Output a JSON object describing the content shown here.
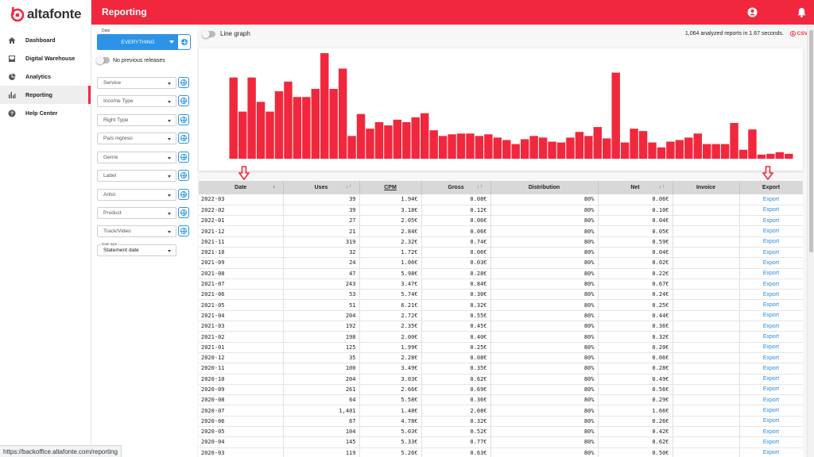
{
  "brand": {
    "name": "altafonte",
    "color": "#f1283d",
    "accent": "#2c93e8"
  },
  "sidebar": {
    "items": [
      {
        "label": "Dashboard",
        "icon": "home-icon",
        "active": false
      },
      {
        "label": "Digital Warehouse",
        "icon": "inbox-icon",
        "active": false
      },
      {
        "label": "Analytics",
        "icon": "pie-chart-icon",
        "active": false
      },
      {
        "label": "Reporting",
        "icon": "bar-chart-icon",
        "active": true
      },
      {
        "label": "Help Center",
        "icon": "help-icon",
        "active": false
      }
    ]
  },
  "topbar": {
    "title": "Reporting",
    "icons": [
      "account-icon",
      "bell-icon"
    ]
  },
  "filters": {
    "date_label": "Date",
    "date_value": "EVERYTHING",
    "no_previous_label": "No previous releases",
    "dropdowns": [
      "Service",
      "Income Type",
      "Right Type",
      "País ingreso",
      "Genre",
      "Label",
      "Artist",
      "Product",
      "Track/Video"
    ],
    "date_type_label": "Date type",
    "date_type_value": "Statement date"
  },
  "main": {
    "line_graph_label": "Line graph",
    "stats": "1,064 analyzed reports in 1.67 seconds.",
    "csv_label": "CSV"
  },
  "chart_data": {
    "type": "bar",
    "values": [
      100,
      58,
      100,
      70,
      58,
      83,
      95,
      76,
      76,
      86,
      130,
      86,
      111,
      28,
      55,
      37,
      45,
      41,
      48,
      45,
      51,
      56,
      35,
      28,
      30,
      31,
      31,
      28,
      30,
      26,
      23,
      18,
      24,
      28,
      26,
      21,
      20,
      26,
      33,
      28,
      39,
      25,
      106,
      20,
      37,
      34,
      20,
      14,
      21,
      23,
      26,
      31,
      18,
      18,
      18,
      44,
      11,
      36,
      5,
      6,
      8,
      6
    ],
    "color": "#f1283d"
  },
  "table": {
    "columns": [
      {
        "label": "Date",
        "sort": "↓"
      },
      {
        "label": "Uses",
        "sort": "↓↑"
      },
      {
        "label": "CPM",
        "sort": "",
        "underline": true
      },
      {
        "label": "Gross",
        "sort": "↓↑"
      },
      {
        "label": "Distribution",
        "sort": ""
      },
      {
        "label": "Net",
        "sort": "↓↑"
      },
      {
        "label": "Invoice",
        "sort": ""
      },
      {
        "label": "Export",
        "sort": ""
      }
    ],
    "rows": [
      [
        "2022-03",
        "39",
        "1.94€",
        "0.08€",
        "80%",
        "0.06€",
        "",
        "Export"
      ],
      [
        "2022-02",
        "39",
        "3.18€",
        "0.12€",
        "80%",
        "0.10€",
        "",
        "Export"
      ],
      [
        "2022-01",
        "27",
        "2.05€",
        "0.06€",
        "80%",
        "0.04€",
        "",
        "Export"
      ],
      [
        "2021-12",
        "21",
        "2.84€",
        "0.06€",
        "80%",
        "0.05€",
        "",
        "Export"
      ],
      [
        "2021-11",
        "319",
        "2.32€",
        "0.74€",
        "80%",
        "0.59€",
        "",
        "Export"
      ],
      [
        "2021-10",
        "32",
        "1.72€",
        "0.06€",
        "80%",
        "0.04€",
        "",
        "Export"
      ],
      [
        "2021-09",
        "24",
        "1.06€",
        "0.03€",
        "80%",
        "0.02€",
        "",
        "Export"
      ],
      [
        "2021-08",
        "47",
        "5.98€",
        "0.28€",
        "80%",
        "0.22€",
        "",
        "Export"
      ],
      [
        "2021-07",
        "243",
        "3.47€",
        "0.84€",
        "80%",
        "0.67€",
        "",
        "Export"
      ],
      [
        "2021-06",
        "53",
        "5.74€",
        "0.30€",
        "80%",
        "0.24€",
        "",
        "Export"
      ],
      [
        "2021-05",
        "51",
        "6.21€",
        "0.32€",
        "80%",
        "0.25€",
        "",
        "Export"
      ],
      [
        "2021-04",
        "204",
        "2.72€",
        "0.55€",
        "80%",
        "0.44€",
        "",
        "Export"
      ],
      [
        "2021-03",
        "192",
        "2.35€",
        "0.45€",
        "80%",
        "0.36€",
        "",
        "Export"
      ],
      [
        "2021-02",
        "198",
        "2.00€",
        "0.40€",
        "80%",
        "0.32€",
        "",
        "Export"
      ],
      [
        "2021-01",
        "125",
        "1.99€",
        "0.25€",
        "80%",
        "0.20€",
        "",
        "Export"
      ],
      [
        "2020-12",
        "35",
        "2.28€",
        "0.08€",
        "80%",
        "0.06€",
        "",
        "Export"
      ],
      [
        "2020-11",
        "100",
        "3.49€",
        "0.35€",
        "80%",
        "0.28€",
        "",
        "Export"
      ],
      [
        "2020-10",
        "204",
        "3.03€",
        "0.62€",
        "80%",
        "0.49€",
        "",
        "Export"
      ],
      [
        "2020-09",
        "261",
        "2.66€",
        "0.69€",
        "80%",
        "0.56€",
        "",
        "Export"
      ],
      [
        "2020-08",
        "64",
        "5.58€",
        "0.36€",
        "80%",
        "0.29€",
        "",
        "Export"
      ],
      [
        "2020-07",
        "1,401",
        "1.48€",
        "2.08€",
        "80%",
        "1.66€",
        "",
        "Export"
      ],
      [
        "2020-06",
        "67",
        "4.78€",
        "0.32€",
        "80%",
        "0.26€",
        "",
        "Export"
      ],
      [
        "2020-05",
        "104",
        "5.03€",
        "0.52€",
        "80%",
        "0.42€",
        "",
        "Export"
      ],
      [
        "2020-04",
        "145",
        "5.33€",
        "0.77€",
        "80%",
        "0.62€",
        "",
        "Export"
      ],
      [
        "2020-03",
        "119",
        "5.26€",
        "0.63€",
        "80%",
        "0.50€",
        "",
        "Export"
      ]
    ]
  },
  "status_url": "https://backoffice.altafonte.com/reporting"
}
